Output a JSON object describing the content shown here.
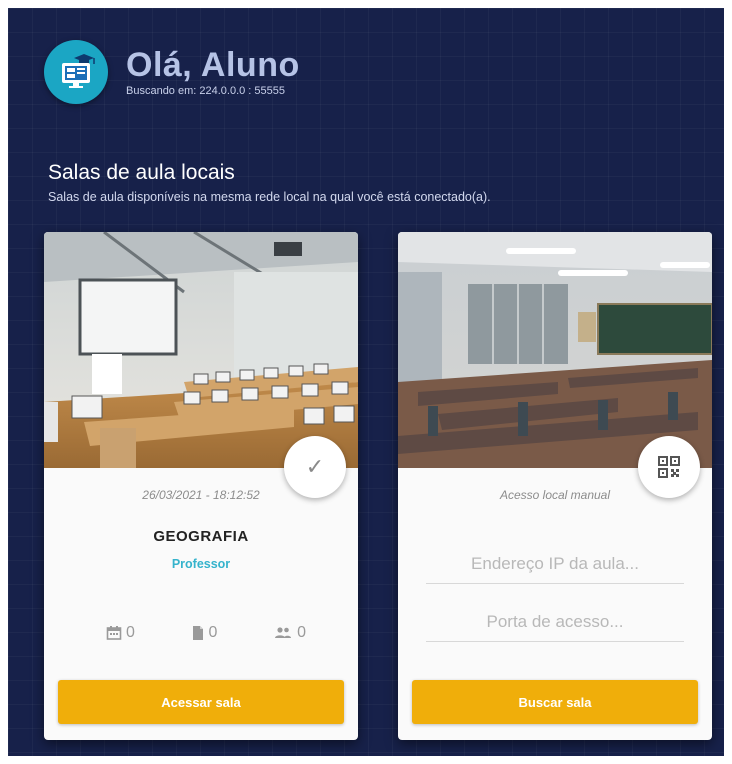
{
  "header": {
    "greeting": "Olá, Aluno",
    "searching": "Buscando em: 224.0.0.0 : 55555"
  },
  "section": {
    "title": "Salas de aula locais",
    "subtitle": "Salas de aula disponíveis na mesma rede local na qual você está conectado(a)."
  },
  "room_card": {
    "datetime": "26/03/2021 - 18:12:52",
    "subject": "GEOGRAFIA",
    "role": "Professor",
    "stats": {
      "calendar": "0",
      "documents": "0",
      "people": "0"
    },
    "status_icon": "check-icon",
    "button_label": "Acessar sala"
  },
  "manual_card": {
    "label": "Acesso local manual",
    "ip_placeholder": "Endereço IP da aula...",
    "port_placeholder": "Porta de acesso...",
    "fab_icon": "qr-code-icon",
    "button_label": "Buscar sala"
  },
  "colors": {
    "background": "#17214a",
    "accent_button": "#f0ae0a",
    "role_text": "#35b3cc",
    "logo": "#1ba6c4"
  }
}
